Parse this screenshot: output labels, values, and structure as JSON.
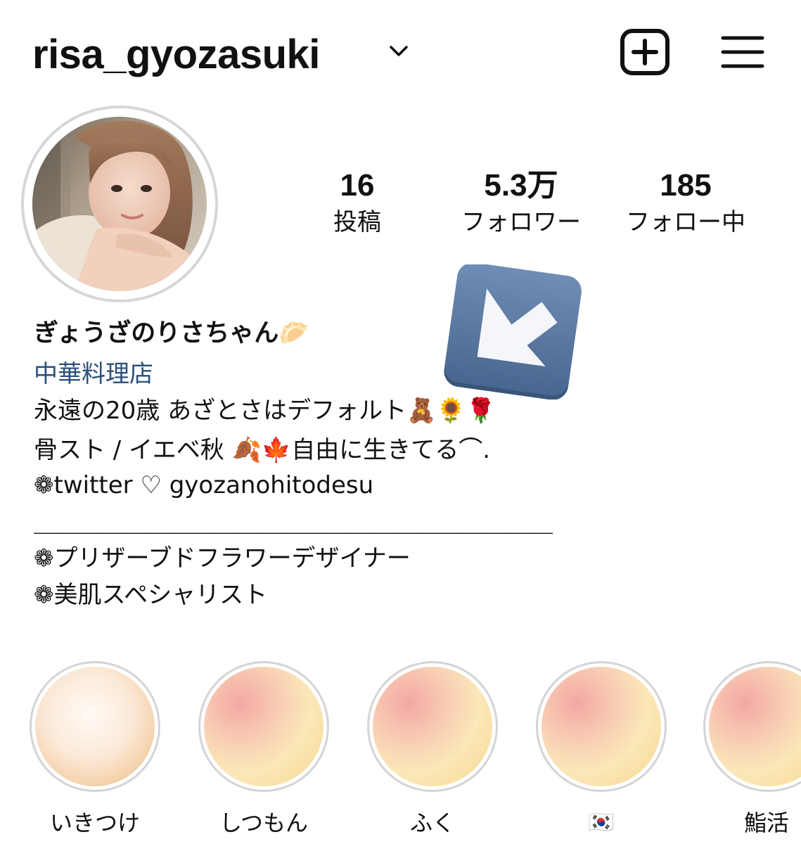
{
  "header": {
    "username": "risa_gyozasuki"
  },
  "stats": [
    {
      "value": "16",
      "label": "投稿"
    },
    {
      "value": "5.3万",
      "label": "フォロワー"
    },
    {
      "value": "185",
      "label": "フォロー中"
    }
  ],
  "bio": {
    "display_name": "ぎょうざのりさちゃん🥟",
    "category": "中華料理店",
    "line1": "永遠の20歳 あざとさはデフォルト🧸🌻🌹",
    "line2": "骨スト / イエベ秋 🍂🍁自由に生きてる⌒.",
    "line3": "❁twitter ♡ gyozanohitodesu",
    "divider": "＿＿＿＿＿＿＿＿＿＿＿＿＿＿＿＿＿＿＿＿＿＿＿",
    "line5": "❁プリザーブドフラワーデザイナー",
    "line6": "❁美肌スペシャリスト"
  },
  "highlights": [
    {
      "label": "いきつけ"
    },
    {
      "label": "しつもん"
    },
    {
      "label": "ふく"
    },
    {
      "label": "🇰🇷"
    },
    {
      "label": "鮨活"
    }
  ],
  "colors": {
    "category_link": "#2b4f7a",
    "arrow_tile": "#5a7aa5"
  },
  "icons": {
    "chevron": "chevron-down-icon",
    "create": "plus-square-icon",
    "menu": "hamburger-menu-icon",
    "overlay": "arrow-down-left-icon"
  }
}
